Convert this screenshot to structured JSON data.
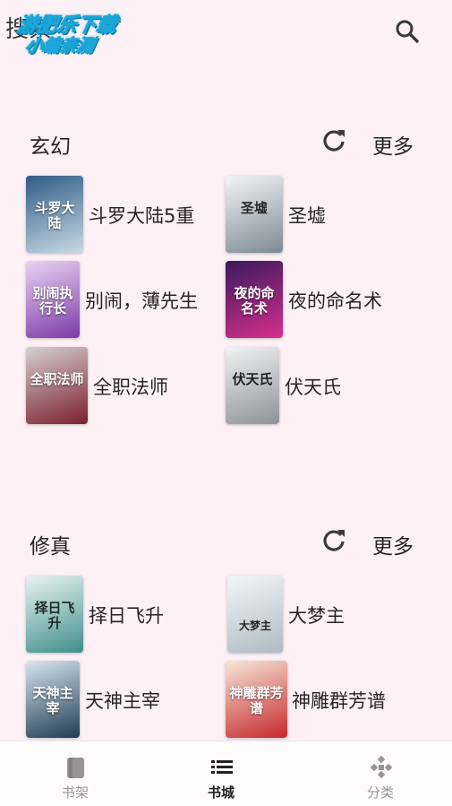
{
  "header": {
    "title": "搜索",
    "watermark_line1": "游肥乐下载",
    "watermark_line2": "小编亲测",
    "search_icon": "search-icon"
  },
  "sections": [
    {
      "title": "玄幻",
      "more_label": "更多",
      "books": [
        {
          "name": "斗罗大陆5重",
          "cover_text": "斗罗大陆",
          "cover_colors": [
            "#2f5c86",
            "#c9d9e4"
          ]
        },
        {
          "name": "圣墟",
          "cover_text": "圣墟",
          "cover_colors": [
            "#f3f5f6",
            "#7d8a93"
          ]
        },
        {
          "name": "别闹，薄先生",
          "cover_text": "别闹执行长",
          "cover_colors": [
            "#e9d4f4",
            "#7c3aa8"
          ]
        },
        {
          "name": "夜的命名术",
          "cover_text": "夜的命名术",
          "cover_colors": [
            "#3b1a5e",
            "#d62f8c"
          ]
        },
        {
          "name": "全职法师",
          "cover_text": "全职法师",
          "cover_colors": [
            "#d6d0d2",
            "#7a1f2d"
          ]
        },
        {
          "name": "伏天氏",
          "cover_text": "伏天氏",
          "cover_colors": [
            "#f2f2f2",
            "#8c9296"
          ]
        }
      ]
    },
    {
      "title": "修真",
      "more_label": "更多",
      "books": [
        {
          "name": "择日飞升",
          "cover_text": "择日飞升",
          "cover_colors": [
            "#eaf3f3",
            "#3f8f8a"
          ]
        },
        {
          "name": "大梦主",
          "cover_text": "大梦主",
          "cover_colors": [
            "#f4f6f6",
            "#aebbc2"
          ]
        },
        {
          "name": "天神主宰",
          "cover_text": "天神主宰",
          "cover_colors": [
            "#d9e6ee",
            "#1f3b55"
          ]
        },
        {
          "name": "神雕群芳谱",
          "cover_text": "神雕群芳谱",
          "cover_colors": [
            "#f7e7d8",
            "#c6282c"
          ]
        }
      ]
    }
  ],
  "bottom_nav": [
    {
      "label": "书架",
      "icon": "book-icon"
    },
    {
      "label": "书城",
      "icon": "list-icon",
      "active": true
    },
    {
      "label": "分类",
      "icon": "grid-icon"
    }
  ],
  "colors": {
    "background": "#fdf1f5",
    "active_nav": "#222222",
    "inactive_nav": "#9a9396"
  }
}
